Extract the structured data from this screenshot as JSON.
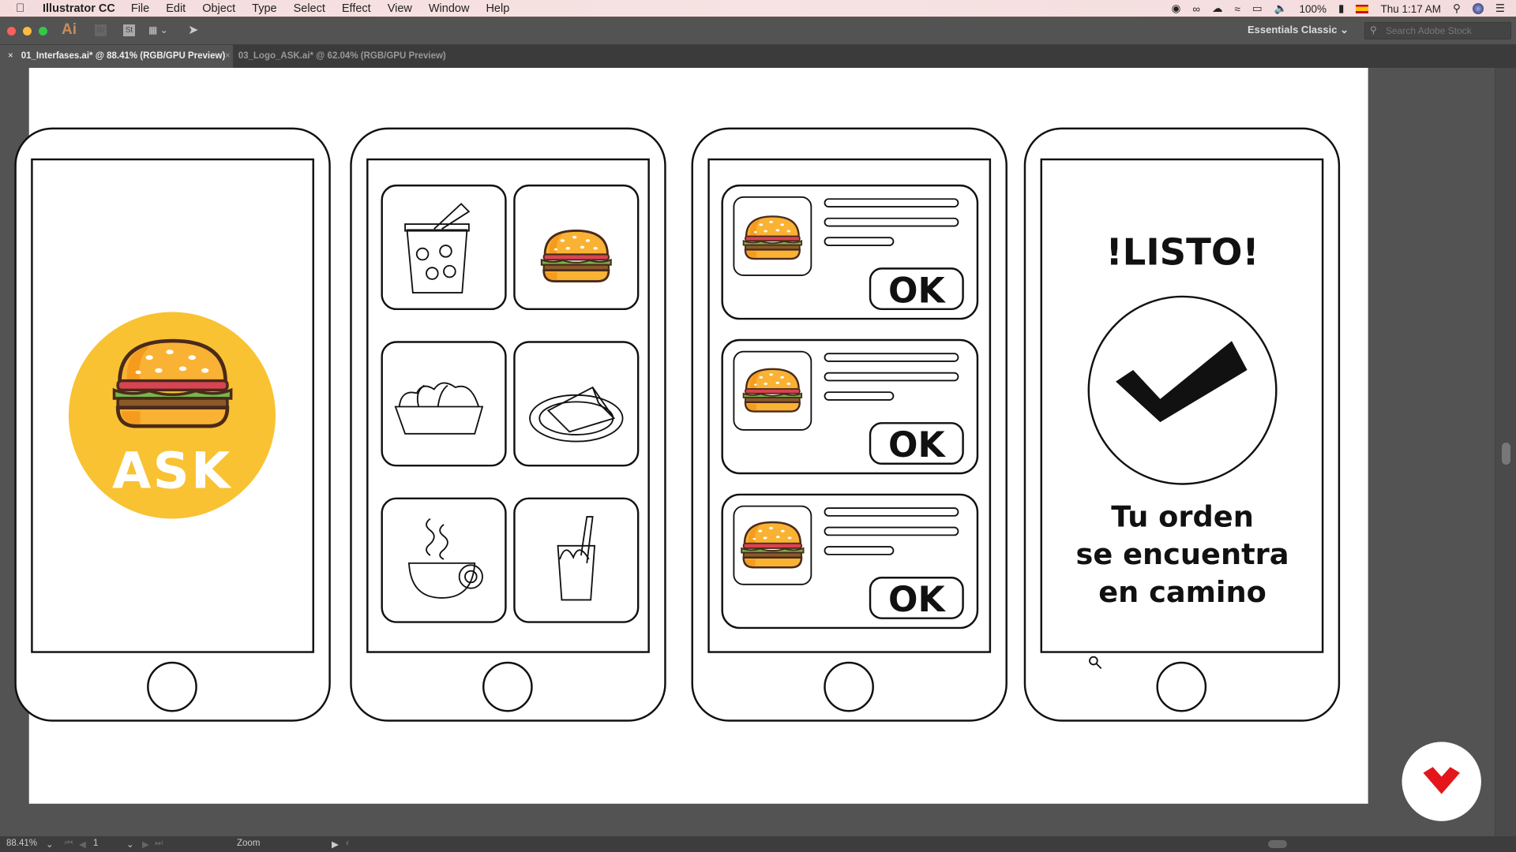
{
  "menubar": {
    "app_name": "Illustrator CC",
    "items": [
      "File",
      "Edit",
      "Object",
      "Type",
      "Select",
      "Effect",
      "View",
      "Window",
      "Help"
    ],
    "battery": "100%",
    "clock": "Thu 1:17 AM"
  },
  "toolbar": {
    "app_logo": "Ai",
    "bridge_label": "Br",
    "stock_label": "St",
    "workspace": "Essentials Classic",
    "search_placeholder": "Search Adobe Stock"
  },
  "tabs": [
    {
      "label": "01_Interfases.ai* @ 88.41% (RGB/GPU Preview)",
      "active": true
    },
    {
      "label": "03_Logo_ASK.ai* @ 62.04% (RGB/GPU Preview)",
      "active": false
    }
  ],
  "artboard": {
    "logo_text": "ASK",
    "order_button_label": "OK",
    "done_title": "!LISTO!",
    "done_message": [
      "Tu orden",
      "se encuentra",
      "en camino"
    ],
    "menu_items": [
      "drink-icon",
      "burger-icon",
      "salad-icon",
      "cake-icon",
      "coffee-icon",
      "juice-icon"
    ]
  },
  "statusbar": {
    "zoom": "88.41%",
    "artboard_number": "1",
    "tool": "Zoom"
  },
  "colors": {
    "logo_yellow": "#F9C232",
    "bun": "#F9B233",
    "tomato": "#D94452",
    "lettuce": "#74B84A",
    "patty": "#8A5A2B",
    "brand_red": "#E3161C"
  }
}
